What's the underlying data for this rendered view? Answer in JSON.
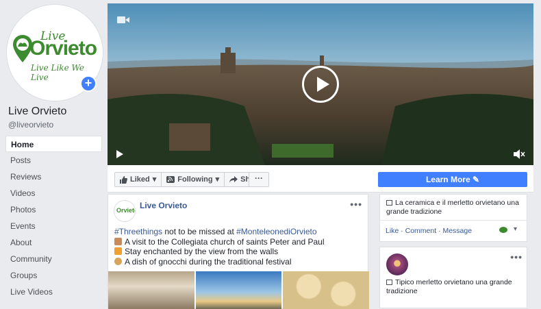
{
  "page": {
    "name": "Live Orvieto",
    "handle": "@liveorvieto",
    "logo_live": "Live",
    "logo_orvieto": "Orvieto",
    "logo_tagline": "Live Like We Live"
  },
  "nav": {
    "items": [
      "Home",
      "Posts",
      "Reviews",
      "Videos",
      "Photos",
      "Events",
      "About",
      "Community",
      "Groups",
      "Live Videos"
    ]
  },
  "actions": {
    "liked": "Liked",
    "following": "Following",
    "share": "Share",
    "more": "···",
    "learn_more": "Learn More"
  },
  "post": {
    "author": "Live Orvieto",
    "menu": "•••",
    "hashtag1": "#Threethings",
    "text_mid": " not to be missed at ",
    "hashtag2": "#MonteleonediOrvieto",
    "line1": "A visit to the Collegiata church of saints Peter and Paul",
    "line2": "Stay enchanted by the view from the walls",
    "line3": "A dish of gnocchi during the traditional festival"
  },
  "right_cards": {
    "card1_text": "La ceramica e il merletto orvietano una grande tradizione",
    "card1_like": "Like",
    "card1_comment": "Comment",
    "card1_message": "Message",
    "card2_text": "Tipico merletto orvietano una grande tradizione",
    "card2_menu": "•••"
  },
  "colors": {
    "brand_green": "#3d8b2f",
    "accent_blue": "#4080ff",
    "link_blue": "#385898"
  }
}
